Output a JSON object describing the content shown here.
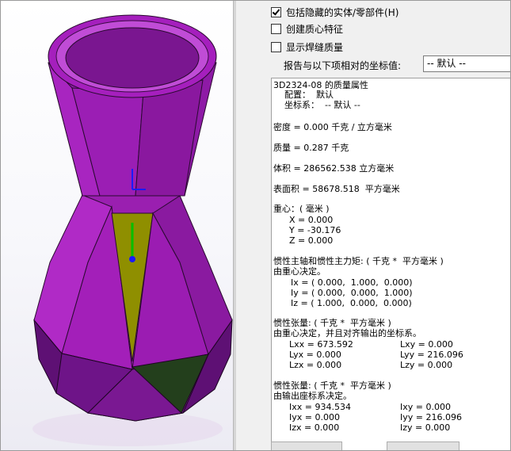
{
  "options": [
    {
      "label": "包括隐藏的实体/零部件(H)",
      "checked": true
    },
    {
      "label": "创建质心特征",
      "checked": false
    },
    {
      "label": "显示焊缝质量",
      "checked": false
    }
  ],
  "coord_label": "报告与以下项相对的坐标值:",
  "coord_value": "-- 默认 --",
  "results": {
    "title": "3D2324-08 的质量属性",
    "config": "配置：  默认",
    "coordsys": "坐标系：  -- 默认 --",
    "density": "密度 = 0.000 千克 / 立方毫米",
    "mass": "质量 = 0.287 千克",
    "volume": "体积 = 286562.538 立方毫米",
    "area": "表面积 = 58678.518  平方毫米",
    "com_header": "重心：( 毫米 )",
    "com_x": "X = 0.000",
    "com_y": "Y = -30.176",
    "com_z": "Z = 0.000",
    "principal_header": "惯性主轴和惯性主力矩: ( 千克 *  平方毫米 )",
    "principal_sub": "由重心决定。",
    "ix": "Ix = ( 0.000,  1.000,  0.000)",
    "iy": "Iy = ( 0.000,  0.000,  1.000)",
    "iz": "Iz = ( 1.000,  0.000,  0.000)",
    "tensor1_header": "惯性张量: ( 千克 *  平方毫米 )",
    "tensor1_sub": "由重心决定，并且对齐输出的坐标系。",
    "lxx": "Lxx = 673.592",
    "lxy": "Lxy = 0.000",
    "lyx": "Lyx = 0.000",
    "lyy": "Lyy = 216.096",
    "lzx": "Lzx = 0.000",
    "lzy": "Lzy = 0.000",
    "tensor2_header": "惯性张量: ( 千克 *  平方毫米 )",
    "tensor2_sub": "由输出座标系决定。",
    "ixx": "Ixx = 934.534",
    "ixy": "Ixy = 0.000",
    "iyx": "Iyx = 0.000",
    "iyy": "Iyy = 216.096",
    "izx": "Izx = 0.000",
    "izy": "Izy = 0.000"
  },
  "colors": {
    "vase_purple": "#a520b8",
    "vase_dark": "#6b1280",
    "face_yellow": "#8a8a00",
    "face_green": "#234a1e",
    "triad_blue": "#1a1aff",
    "triad_green": "#00c000"
  }
}
